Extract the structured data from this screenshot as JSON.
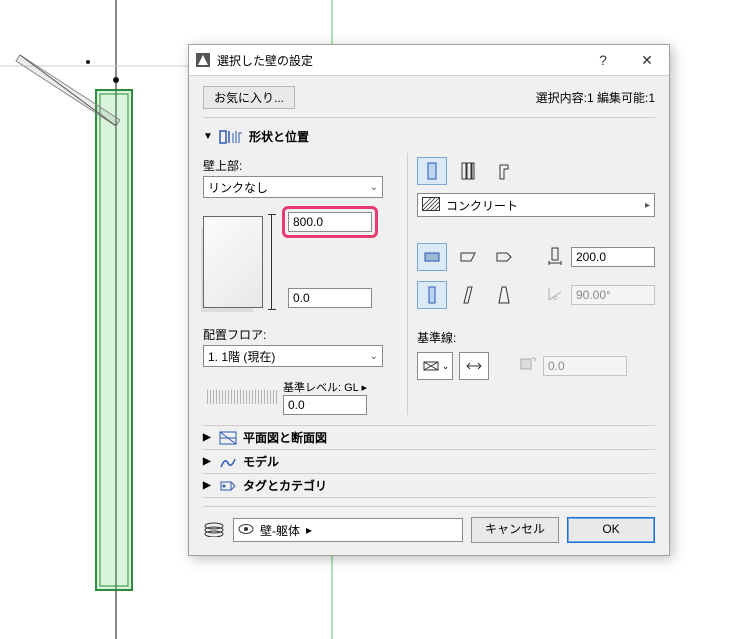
{
  "window": {
    "title": "選択した壁の設定"
  },
  "toolbar": {
    "favorites_label": "お気に入り...",
    "selection_info": "選択内容:1 編集可能:1"
  },
  "sections": {
    "shape_position": "形状と位置",
    "plan_section": "平面図と断面図",
    "model": "モデル",
    "tag_category": "タグとカテゴリ"
  },
  "labels": {
    "wall_top": "壁上部:",
    "home_floor": "配置フロア:",
    "base_level": "基準レベル: GL",
    "ref_line": "基準線:"
  },
  "values": {
    "top_link": "リンクなし",
    "home_floor": "1. 1階 (現在)",
    "height_top": "800.0",
    "height_bottom": "0.0",
    "base_offset": "0.0",
    "material": "コンクリート",
    "thickness": "200.0",
    "angle": "90.00°",
    "ref_offset": "0.0"
  },
  "footer": {
    "layer": "壁-躯体",
    "cancel": "キャンセル",
    "ok": "OK"
  },
  "glyphs": {
    "help": "?",
    "close": "✕",
    "tri_down": "▼",
    "tri_right": "▶",
    "chev_down": "⌄",
    "chev_right": "▸",
    "bracket": "⟭"
  }
}
